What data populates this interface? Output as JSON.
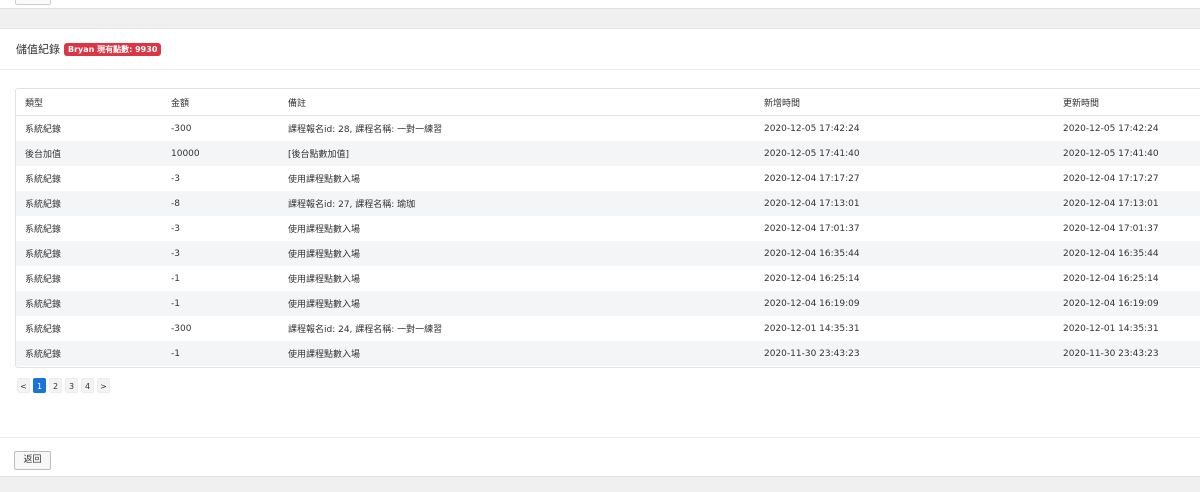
{
  "header": {
    "title": "儲值紀錄",
    "badge": "Bryan 現有點數: 9930"
  },
  "table": {
    "columns": [
      "類型",
      "金額",
      "備註",
      "新增時間",
      "更新時間"
    ],
    "rows": [
      [
        "系統紀錄",
        "-300",
        "課程報名id: 28, 課程名稱: 一對一練習",
        "2020-12-05 17:42:24",
        "2020-12-05 17:42:24"
      ],
      [
        "後台加值",
        "10000",
        "[後台點數加值]",
        "2020-12-05 17:41:40",
        "2020-12-05 17:41:40"
      ],
      [
        "系統紀錄",
        "-3",
        "使用課程點數入場",
        "2020-12-04 17:17:27",
        "2020-12-04 17:17:27"
      ],
      [
        "系統紀錄",
        "-8",
        "課程報名id: 27, 課程名稱: 瑜珈",
        "2020-12-04 17:13:01",
        "2020-12-04 17:13:01"
      ],
      [
        "系統紀錄",
        "-3",
        "使用課程點數入場",
        "2020-12-04 17:01:37",
        "2020-12-04 17:01:37"
      ],
      [
        "系統紀錄",
        "-3",
        "使用課程點數入場",
        "2020-12-04 16:35:44",
        "2020-12-04 16:35:44"
      ],
      [
        "系統紀錄",
        "-1",
        "使用課程點數入場",
        "2020-12-04 16:25:14",
        "2020-12-04 16:25:14"
      ],
      [
        "系統紀錄",
        "-1",
        "使用課程點數入場",
        "2020-12-04 16:19:09",
        "2020-12-04 16:19:09"
      ],
      [
        "系統紀錄",
        "-300",
        "課程報名id: 24, 課程名稱: 一對一練習",
        "2020-12-01 14:35:31",
        "2020-12-01 14:35:31"
      ],
      [
        "系統紀錄",
        "-1",
        "使用課程點數入場",
        "2020-11-30 23:43:23",
        "2020-11-30 23:43:23"
      ]
    ]
  },
  "pagination": {
    "prev": "<",
    "pages": [
      "1",
      "2",
      "3",
      "4"
    ],
    "active_page": "1",
    "next": ">"
  },
  "footer": {
    "back_label": "返回"
  },
  "colors": {
    "badge": "#dc3545",
    "active_page": "#1a73d9"
  }
}
